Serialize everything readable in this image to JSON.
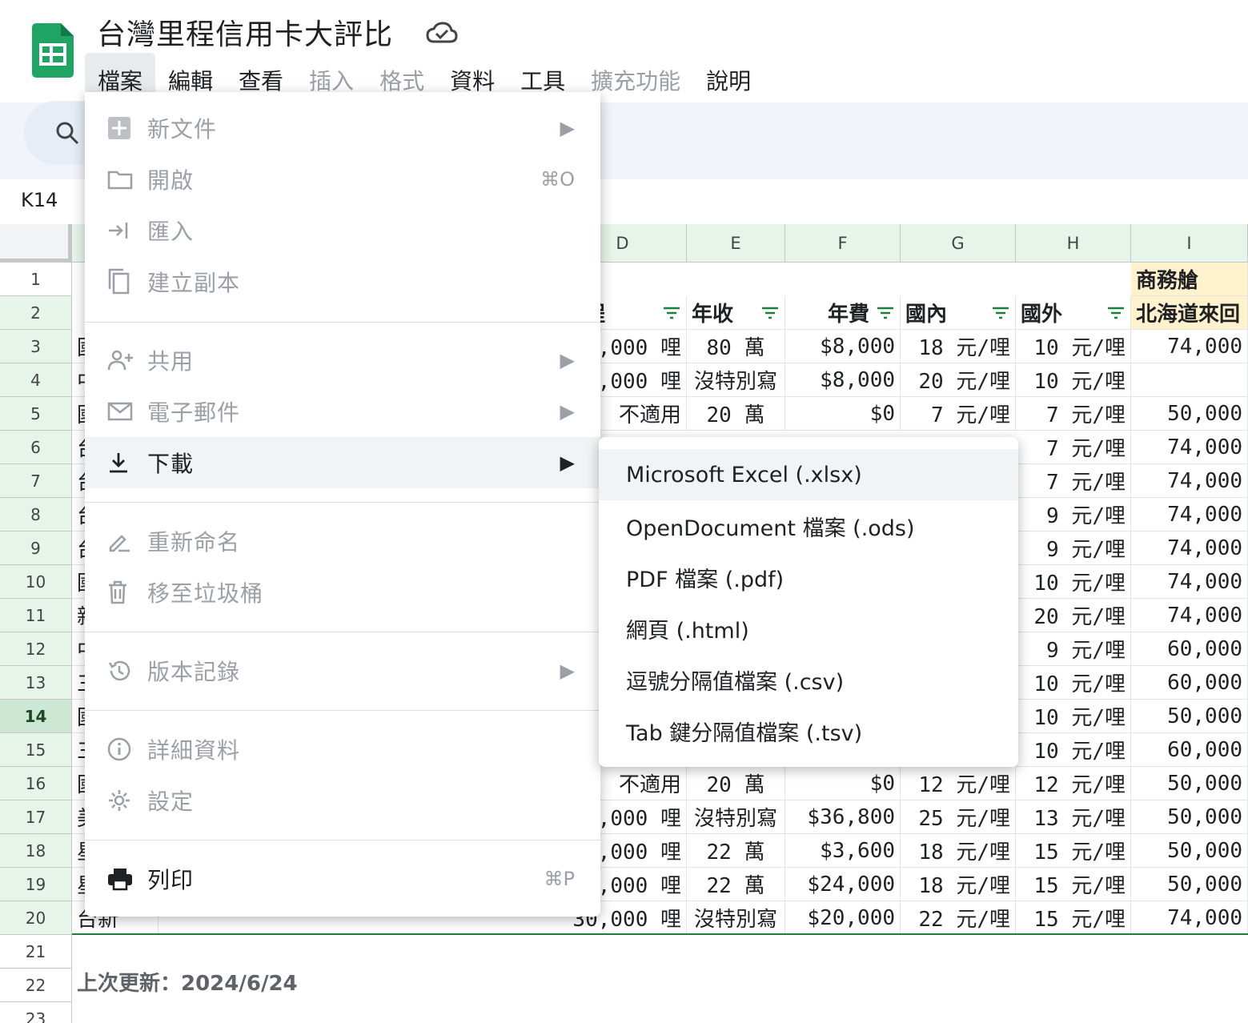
{
  "doc_title": "台灣里程信用卡大評比",
  "menubar": [
    {
      "label": "檔案",
      "state": "active"
    },
    {
      "label": "編輯",
      "state": "normal"
    },
    {
      "label": "查看",
      "state": "normal"
    },
    {
      "label": "插入",
      "state": "disabled"
    },
    {
      "label": "格式",
      "state": "disabled"
    },
    {
      "label": "資料",
      "state": "normal"
    },
    {
      "label": "工具",
      "state": "normal"
    },
    {
      "label": "擴充功能",
      "state": "disabled"
    },
    {
      "label": "說明",
      "state": "normal"
    }
  ],
  "name_box": "K14",
  "file_menu": {
    "new": {
      "label": "新文件"
    },
    "open": {
      "label": "開啟",
      "shortcut": "⌘O"
    },
    "import": {
      "label": "匯入"
    },
    "copy": {
      "label": "建立副本"
    },
    "share": {
      "label": "共用"
    },
    "email": {
      "label": "電子郵件"
    },
    "download": {
      "label": "下載"
    },
    "rename": {
      "label": "重新命名"
    },
    "trash": {
      "label": "移至垃圾桶"
    },
    "version": {
      "label": "版本記錄"
    },
    "details": {
      "label": "詳細資料"
    },
    "settings": {
      "label": "設定"
    },
    "print": {
      "label": "列印",
      "shortcut": "⌘P"
    }
  },
  "download_submenu": [
    "Microsoft Excel (.xlsx)",
    "OpenDocument 檔案 (.ods)",
    "PDF 檔案 (.pdf)",
    "網頁 (.html)",
    "逗號分隔值檔案 (.csv)",
    "Tab 鍵分隔值檔案 (.tsv)"
  ],
  "columns": [
    "D",
    "E",
    "F",
    "G",
    "H",
    "I"
  ],
  "rows": [
    "1",
    "2",
    "3",
    "4",
    "5",
    "6",
    "7",
    "8",
    "9",
    "10",
    "11",
    "12",
    "13",
    "14",
    "15",
    "16",
    "17",
    "18",
    "19",
    "20",
    "21",
    "22",
    "23"
  ],
  "header_row1": {
    "I": "商務艙"
  },
  "header_row2": {
    "D": "里程",
    "E": "年收",
    "F": "年費",
    "G": "國內",
    "H": "國外",
    "I": "北海道來回"
  },
  "table_rows": [
    {
      "r": 3,
      "A": "國",
      "D": ",000 哩",
      "E": "80 萬",
      "F": "$8,000",
      "G": "18 元/哩",
      "H": "10 元/哩",
      "I": "74,000"
    },
    {
      "r": 4,
      "A": "中",
      "D": ",000 哩",
      "E": "沒特別寫",
      "F": "$8,000",
      "G": "20 元/哩",
      "H": "10 元/哩",
      "I": ""
    },
    {
      "r": 5,
      "A": "國",
      "D": "不適用",
      "E": "20 萬",
      "F": "$0",
      "G": "7 元/哩",
      "H": "7 元/哩",
      "I": "50,000"
    },
    {
      "r": 6,
      "A": "台",
      "H": "7 元/哩",
      "I": "74,000"
    },
    {
      "r": 7,
      "A": "台",
      "H": "7 元/哩",
      "I": "74,000"
    },
    {
      "r": 8,
      "A": "台",
      "H": "9 元/哩",
      "I": "74,000"
    },
    {
      "r": 9,
      "A": "台",
      "H": "9 元/哩",
      "I": "74,000"
    },
    {
      "r": 10,
      "A": "國",
      "H": "10 元/哩",
      "I": "74,000"
    },
    {
      "r": 11,
      "A": "新",
      "H": "20 元/哩",
      "I": "74,000"
    },
    {
      "r": 12,
      "A": "中",
      "H": "9 元/哩",
      "I": "60,000"
    },
    {
      "r": 13,
      "A": "三",
      "H": "10 元/哩",
      "I": "60,000"
    },
    {
      "r": 14,
      "A": "國",
      "H": "10 元/哩",
      "I": "50,000"
    },
    {
      "r": 15,
      "A": "三",
      "H": "10 元/哩",
      "I": "60,000"
    },
    {
      "r": 16,
      "A": "國",
      "D": "不適用",
      "E": "20 萬",
      "F": "$0",
      "G": "12 元/哩",
      "H": "12 元/哩",
      "I": "50,000"
    },
    {
      "r": 17,
      "A": "美",
      "D": ",000 哩",
      "E": "沒特別寫",
      "F": "$36,800",
      "G": "25 元/哩",
      "H": "13 元/哩",
      "I": "50,000"
    },
    {
      "r": 18,
      "A": "星",
      "D": ",000 哩",
      "E": "22 萬",
      "F": "$3,600",
      "G": "18 元/哩",
      "H": "15 元/哩",
      "I": "50,000"
    },
    {
      "r": 19,
      "A": "星",
      "D": ",000 哩",
      "E": "22 萬",
      "F": "$24,000",
      "G": "18 元/哩",
      "H": "15 元/哩",
      "I": "50,000"
    },
    {
      "r": 20,
      "A": "台新",
      "D": "30,000 哩",
      "E": "沒特別寫",
      "F": "$20,000",
      "G": "22 元/哩",
      "H": "15 元/哩",
      "I": "74,000"
    }
  ],
  "last_updated": "上次更新：2024/6/24"
}
